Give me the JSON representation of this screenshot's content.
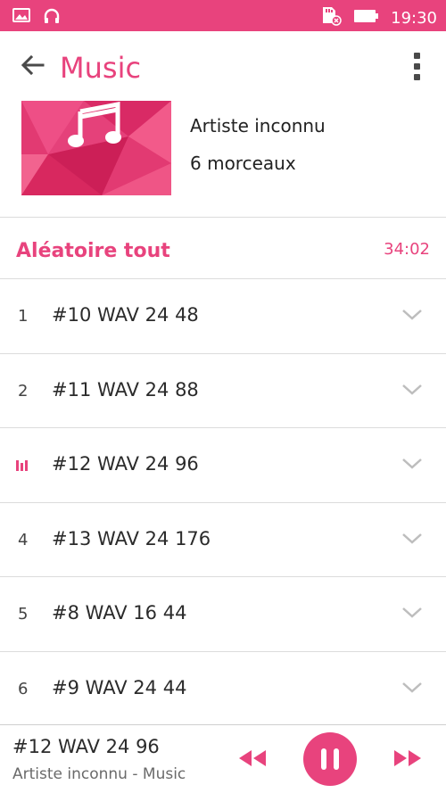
{
  "status_bar": {
    "time": "19:30",
    "icons": [
      "gallery-icon",
      "headset-icon",
      "sd-card-icon",
      "battery-icon"
    ]
  },
  "app_bar": {
    "title": "Music",
    "icons": [
      "back-arrow-icon",
      "overflow-menu-icon"
    ]
  },
  "album": {
    "artist": "Artiste inconnu",
    "track_count": "6 morceaux",
    "art_icon": "music-note-icon"
  },
  "shuffle": {
    "label": "Aléatoire tout",
    "duration": "34:02"
  },
  "tracks": [
    {
      "number": "1",
      "title": "#10 WAV 24 48",
      "playing": false
    },
    {
      "number": "2",
      "title": "#11 WAV 24 88",
      "playing": false
    },
    {
      "number": "",
      "title": "#12 WAV 24 96",
      "playing": true
    },
    {
      "number": "4",
      "title": "#13 WAV 24 176",
      "playing": false
    },
    {
      "number": "5",
      "title": "#8 WAV 16 44",
      "playing": false
    },
    {
      "number": "6",
      "title": "#9 WAV 24 44",
      "playing": false
    }
  ],
  "now_playing": {
    "title": "#12 WAV 24 96",
    "subtitle": "Artiste inconnu - Music",
    "controls": [
      "rewind-icon",
      "pause-icon",
      "fast-forward-icon"
    ]
  },
  "colors": {
    "accent": "#e8437d",
    "divider": "#dcdcdc",
    "text": "#2b2b2b"
  }
}
